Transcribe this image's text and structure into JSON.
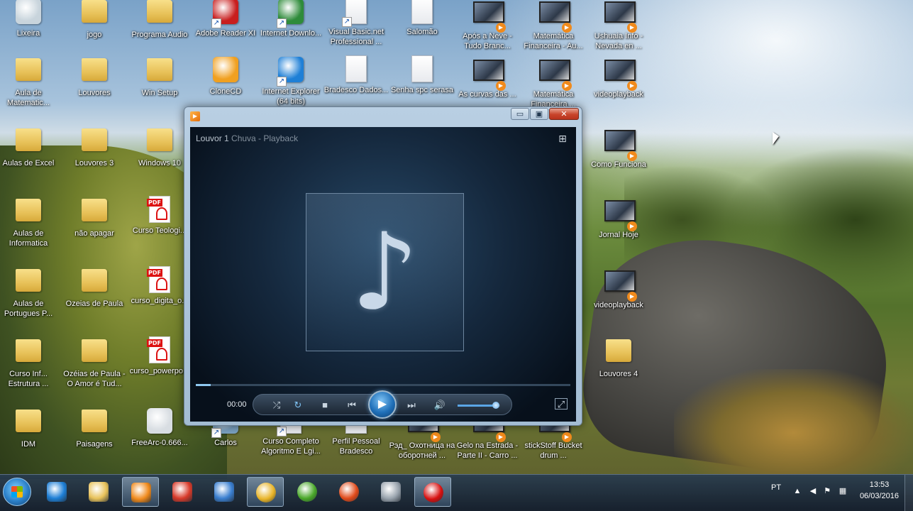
{
  "desktop": {
    "icons": [
      {
        "label": "Lixeira",
        "type": "app",
        "color": "#c8d4dc",
        "icon": "recycle-bin-icon"
      },
      {
        "label": "jogo",
        "type": "folder",
        "icon": "folder-icon"
      },
      {
        "label": "Programa Audio",
        "type": "folder",
        "icon": "folder-icon"
      },
      {
        "label": "Adobe Reader XI",
        "type": "app",
        "color": "#c81e1e",
        "icon": "adobe-reader-icon",
        "shortcut": true
      },
      {
        "label": "Internet Downlo...",
        "type": "app",
        "color": "#2e8b3a",
        "icon": "internet-download-manager-icon",
        "shortcut": true
      },
      {
        "label": "Visual Basic.net Professional ...",
        "type": "doc",
        "icon": "document-icon",
        "shortcut": true
      },
      {
        "label": "Salomão",
        "type": "doc",
        "icon": "document-icon"
      },
      {
        "label": "Após a Neve - Tudo Branc...",
        "type": "video",
        "icon": "video-file-icon"
      },
      {
        "label": "Matemática Financeira - Au...",
        "type": "video",
        "icon": "video-file-icon"
      },
      {
        "label": "Ushuaia Info - Nevada en ...",
        "type": "video",
        "icon": "video-file-icon"
      },
      {
        "label": "Aula de Matematic...",
        "type": "folder",
        "icon": "folder-icon"
      },
      {
        "label": "Louvores",
        "type": "folder",
        "icon": "folder-icon"
      },
      {
        "label": "Win Setup",
        "type": "folder",
        "icon": "folder-icon"
      },
      {
        "label": "CloneCD",
        "type": "app",
        "color": "#f0a020",
        "icon": "clonecd-icon"
      },
      {
        "label": "Internet Explorer (64 bits)",
        "type": "app",
        "color": "#1e7fd6",
        "icon": "internet-explorer-icon",
        "shortcut": true
      },
      {
        "label": "Bradesco Dados...",
        "type": "doc",
        "icon": "document-icon"
      },
      {
        "label": "Senha spc serasa",
        "type": "doc",
        "icon": "document-icon"
      },
      {
        "label": "As curvas das ...",
        "type": "video",
        "icon": "video-file-icon"
      },
      {
        "label": "Matemática Financeira ...",
        "type": "video",
        "icon": "video-file-icon"
      },
      {
        "label": "videoplayback",
        "type": "video",
        "icon": "video-file-icon"
      },
      {
        "label": "Aulas de Excel",
        "type": "folder",
        "icon": "folder-icon"
      },
      {
        "label": "Louvores 3",
        "type": "folder",
        "icon": "folder-icon"
      },
      {
        "label": "Windows 10",
        "type": "folder",
        "icon": "folder-icon"
      },
      {
        "label": "Como Funciona",
        "type": "video",
        "icon": "video-file-icon"
      },
      {
        "label": "Aulas de Informatica",
        "type": "folder",
        "icon": "folder-icon"
      },
      {
        "label": "não apagar",
        "type": "folder",
        "icon": "folder-icon"
      },
      {
        "label": "Curso Teologi...",
        "type": "pdf",
        "icon": "pdf-file-icon"
      },
      {
        "label": "Jornal Hoje",
        "type": "video",
        "icon": "video-file-icon"
      },
      {
        "label": "Aulas de Portugues P...",
        "type": "folder",
        "icon": "folder-icon"
      },
      {
        "label": "Ozeias de Paula",
        "type": "folder",
        "icon": "folder-icon"
      },
      {
        "label": "curso_digita_o...",
        "type": "pdf",
        "icon": "pdf-file-icon"
      },
      {
        "label": "videoplayback",
        "type": "video",
        "icon": "video-file-icon"
      },
      {
        "label": "Curso Inf... Estrutura ...",
        "type": "folder",
        "icon": "folder-icon"
      },
      {
        "label": "Ozéias de Paula - O Amor é Tud...",
        "type": "folder",
        "icon": "folder-icon"
      },
      {
        "label": "curso_powerpo...",
        "type": "pdf",
        "icon": "pdf-file-icon"
      },
      {
        "label": "Louvores 4",
        "type": "folder",
        "icon": "folder-icon"
      },
      {
        "label": "IDM",
        "type": "folder",
        "icon": "folder-icon"
      },
      {
        "label": "Paisagens",
        "type": "folder",
        "icon": "folder-icon"
      },
      {
        "label": "FreeArc-0.666...",
        "type": "app",
        "color": "#d8dde2",
        "icon": "freearc-installer-icon"
      },
      {
        "label": "Carlos",
        "type": "app",
        "color": "#7aa0c0",
        "icon": "contact-icon",
        "shortcut": true
      },
      {
        "label": "Curso Completo Algoritmo E Lgi...",
        "type": "doc",
        "icon": "document-icon",
        "shortcut": true
      },
      {
        "label": "Perfil Pessoal Bradesco",
        "type": "doc",
        "icon": "document-icon"
      },
      {
        "label": "Рэд_ Охотница на оборотней ...",
        "type": "video",
        "icon": "video-file-icon"
      },
      {
        "label": "Gelo na Estrada - Parte II - Carro ...",
        "type": "video",
        "icon": "video-file-icon"
      },
      {
        "label": "stickStoff Bucket drum ...",
        "type": "video",
        "icon": "video-file-icon"
      }
    ]
  },
  "player": {
    "title_overlay": "Louvor 1",
    "title_text": "Louvor 1 Chuva - Playback",
    "time": "00:00",
    "progress": 0.04,
    "volume": 0.9,
    "caption": {
      "minimize": "▭",
      "maximize": "▣",
      "close": "✕"
    },
    "controls": {
      "shuffle": "⤮",
      "repeat": "↻",
      "stop": "■",
      "previous": "⏮",
      "play": "▶",
      "next": "⏭",
      "mute": "🔊",
      "switch_view": "⊞",
      "fullscreen": "⤢"
    },
    "note_glyph": "♪"
  },
  "taskbar": {
    "items": [
      {
        "name": "internet-explorer",
        "color": "#1e7fd6",
        "icon": "internet-explorer-icon"
      },
      {
        "name": "windows-explorer",
        "color": "#e8c25a",
        "icon": "folder-icon"
      },
      {
        "name": "windows-media-player",
        "color": "#f08a1c",
        "icon": "media-player-icon",
        "active": true
      },
      {
        "name": "ccleaner",
        "color": "#d83a2a",
        "icon": "ccleaner-icon"
      },
      {
        "name": "tool",
        "color": "#3a7fd0",
        "icon": "tool-icon"
      },
      {
        "name": "google-chrome",
        "color": "#e8b428",
        "icon": "chrome-icon",
        "active": true
      },
      {
        "name": "utorrent",
        "color": "#4aa82a",
        "icon": "utorrent-icon"
      },
      {
        "name": "flash",
        "color": "#e04a1a",
        "icon": "flash-icon"
      },
      {
        "name": "truck-app",
        "color": "#9aa4ae",
        "icon": "truck-icon"
      },
      {
        "name": "recorder",
        "color": "#d81010",
        "icon": "record-icon",
        "active": true
      }
    ],
    "tray": {
      "language": "PT",
      "time": "13:53",
      "date": "06/03/2016"
    }
  }
}
